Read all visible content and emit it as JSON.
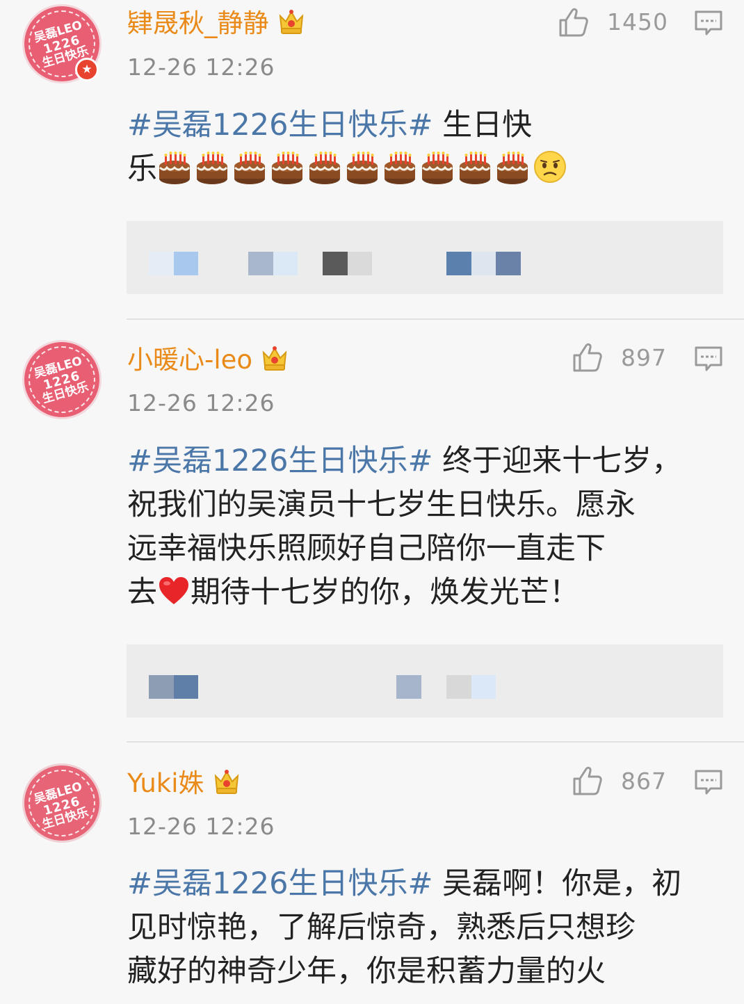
{
  "comments": [
    {
      "username": "肄晟秋_静静",
      "timestamp": "12-26 12:26",
      "like_count": "1450",
      "avatar_text": [
        "吴磊LEO",
        "1226",
        "生日快乐"
      ],
      "has_avatar_badge": true,
      "hashtag": "#吴磊1226生日快乐#",
      "text_line1": " 生日快",
      "text_line2": "乐",
      "emojis": {
        "cakes": 10,
        "trailing": "sad-face"
      }
    },
    {
      "username": "小暖心-leo",
      "timestamp": "12-26 12:26",
      "like_count": "897",
      "avatar_text": [
        "吴磊LEO",
        "1226",
        "生日快乐"
      ],
      "hashtag": "#吴磊1226生日快乐#",
      "text_first": " 终于迎来十七岁，",
      "text_lines": [
        "祝我们的吴演员十七岁生日快乐。愿永",
        "远幸福快乐照顾好自己陪你一直走下"
      ],
      "text_last_before": "去",
      "text_last_after": "期待十七岁的你，焕发光芒！"
    },
    {
      "username": "Yuki姝",
      "timestamp": "12-26 12:26",
      "like_count": "867",
      "avatar_text": [
        "吴磊LEO",
        "1226",
        "生日快乐"
      ],
      "hashtag": "#吴磊1226生日快乐#",
      "text_first": " 吴磊啊！你是，初",
      "text_lines": [
        "见时惊艳，了解后惊奇，熟悉后只想珍",
        "藏好的神奇少年，你是积蓄力量的火"
      ]
    }
  ],
  "icons": {
    "like": "thumbs-up-icon",
    "reply": "comment-icon",
    "vip": "crown-icon",
    "badge": "star-badge-icon"
  },
  "colors": {
    "username": "#e98a19",
    "hashtag": "#4a76a8",
    "avatar": "#e85f73",
    "text": "#222222",
    "meta": "#8a8a8a"
  }
}
